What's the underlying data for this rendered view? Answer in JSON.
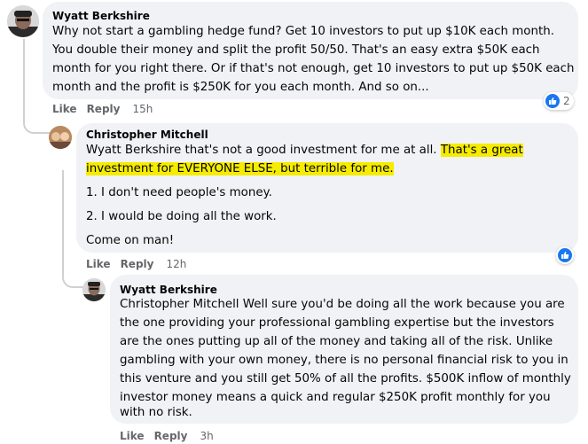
{
  "comment1": {
    "author": "Wyatt Berkshire",
    "lines": [
      "Why not start a gambling hedge fund? Get 10 investors to put up $10K each month.",
      "You double their money and split the profit 50/50. That's an easy extra $50K each",
      "month for you right there. Or if that's not enough, get 10 investors to put up $50K each",
      "month and the profit is $250K for you each month. And so on..."
    ],
    "actions": {
      "like": "Like",
      "reply": "Reply",
      "time": "15h"
    },
    "reaction_count": "2"
  },
  "comment2": {
    "author": "Christopher Mitchell",
    "mention": "Wyatt Berkshire",
    "line1_text": " that's not a good investment for me at all. ",
    "line1_highlight": "That's a great",
    "line2_highlight": "investment for EVERYONE ELSE, but terrible for me.",
    "point1": "1. I don't need people's money.",
    "point2": "2. I would be doing all the work.",
    "closing": "Come on man!",
    "actions": {
      "like": "Like",
      "reply": "Reply",
      "time": "12h"
    }
  },
  "comment3": {
    "author": "Wyatt Berkshire",
    "mention": "Christopher Mitchell",
    "line1_text": " Well sure you'd be doing all the work because you are",
    "lines": [
      "the one providing your professional gambling expertise but the investors",
      "are the ones putting up all of the money and taking all of the risk. Unlike",
      "gambling with your own money, there is no personal financial risk to you in",
      "this venture and you still get 50% of all the profits. $500K inflow of monthly",
      "investor money means a quick and regular $250K profit monthly for you",
      "with no risk."
    ],
    "actions": {
      "like": "Like",
      "reply": "Reply",
      "time": "3h"
    }
  },
  "colors": {
    "bubble": "#f0f2f5",
    "highlight": "#f6ec00",
    "like_blue": "#1877f2",
    "meta_gray": "#65676b"
  }
}
